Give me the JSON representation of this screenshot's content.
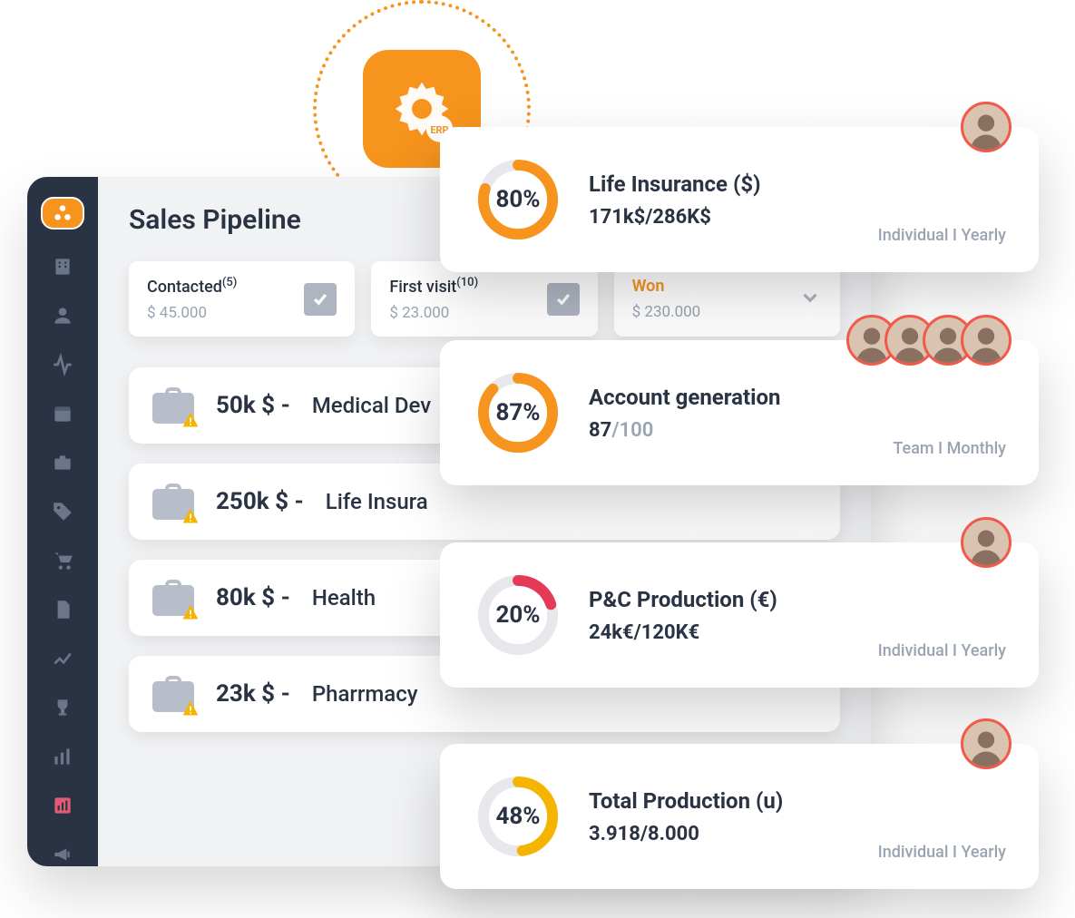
{
  "erp": {
    "label": "ERP"
  },
  "dashboard": {
    "title": "Sales Pipeline",
    "stages": [
      {
        "label": "Contacted",
        "count": "(5)",
        "amount": "$ 45.000",
        "done": true
      },
      {
        "label": "First visit",
        "count": "(10)",
        "amount": "$ 23.000",
        "done": true
      },
      {
        "label": "Won",
        "count": "",
        "amount": "$ 230.000",
        "won": true
      }
    ],
    "deals": [
      {
        "value": "50k $ -",
        "name": "Medical Dev"
      },
      {
        "value": "250k $ -",
        "name": "Life Insura"
      },
      {
        "value": "80k $ -",
        "name": "Health"
      },
      {
        "value": "23k $ -",
        "name": "Pharrmacy"
      }
    ]
  },
  "kpis": [
    {
      "pct": 80,
      "pct_label": "80%",
      "color": "#f7941d",
      "title": "Life Insurance ($)",
      "value": "171k$/286K$",
      "meta": "Individual I Yearly",
      "avatars": 1
    },
    {
      "pct": 87,
      "pct_label": "87%",
      "color": "#f7941d",
      "title": "Account generation",
      "value": "87",
      "value_suffix": "/100",
      "meta": "Team I Monthly",
      "avatars": 4
    },
    {
      "pct": 20,
      "pct_label": "20%",
      "color": "#e53958",
      "title": "P&C Production (€)",
      "value": "24k€/120K€",
      "meta": "Individual I Yearly",
      "avatars": 1
    },
    {
      "pct": 48,
      "pct_label": "48%",
      "color": "#f5b400",
      "title": "Total Production (u)",
      "value": "3.918/8.000",
      "meta": "Individual I Yearly",
      "avatars": 1
    }
  ],
  "chart_data": [
    {
      "type": "pie",
      "title": "Life Insurance ($)",
      "values": [
        80,
        20
      ],
      "categories": [
        "complete",
        "remaining"
      ]
    },
    {
      "type": "pie",
      "title": "Account generation",
      "values": [
        87,
        13
      ],
      "categories": [
        "complete",
        "remaining"
      ]
    },
    {
      "type": "pie",
      "title": "P&C Production (€)",
      "values": [
        20,
        80
      ],
      "categories": [
        "complete",
        "remaining"
      ]
    },
    {
      "type": "pie",
      "title": "Total Production (u)",
      "values": [
        48,
        52
      ],
      "categories": [
        "complete",
        "remaining"
      ]
    }
  ]
}
